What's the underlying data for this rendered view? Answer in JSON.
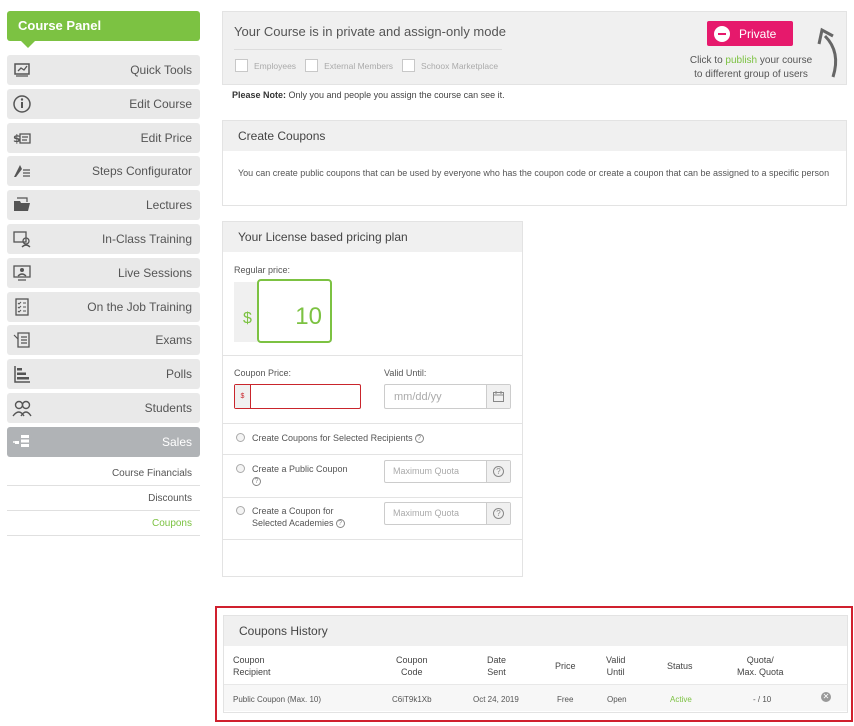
{
  "sidebar": {
    "header": "Course Panel",
    "items": [
      {
        "label": "Quick Tools",
        "icon": "board-icon"
      },
      {
        "label": "Edit Course",
        "icon": "info-icon"
      },
      {
        "label": "Edit Price",
        "icon": "price-icon"
      },
      {
        "label": "Steps Configurator",
        "icon": "steps-icon"
      },
      {
        "label": "Lectures",
        "icon": "folder-icon"
      },
      {
        "label": "In-Class Training",
        "icon": "classroom-icon"
      },
      {
        "label": "Live Sessions",
        "icon": "live-icon"
      },
      {
        "label": "On the Job Training",
        "icon": "checklist-icon"
      },
      {
        "label": "Exams",
        "icon": "exam-icon"
      },
      {
        "label": "Polls",
        "icon": "poll-icon"
      },
      {
        "label": "Students",
        "icon": "students-icon"
      },
      {
        "label": "Sales",
        "icon": "sales-icon"
      }
    ],
    "sub_items": [
      "Course Financials",
      "Discounts",
      "Coupons"
    ]
  },
  "privacy": {
    "title": "Your Course is in private and assign-only mode",
    "checkboxes": [
      "Employees",
      "External Members",
      "Schoox Marketplace"
    ],
    "button_label": "Private",
    "note_pre": "Click to ",
    "note_link": "publish",
    "note_post": " your course",
    "note_line2": "to different group of users",
    "please_bold": "Please Note:",
    "please_text": " Only you and people you assign the course can see it."
  },
  "create": {
    "title": "Create Coupons",
    "text": "You can create public coupons that can be used by everyone who has the coupon code or create a coupon that can be assigned to a specific person"
  },
  "license": {
    "title": "Your License based pricing plan",
    "regular_label": "Regular price:",
    "currency": "$",
    "regular_value": "10",
    "coupon_price_label": "Coupon Price:",
    "coupon_prefix": "$",
    "valid_until_label": "Valid Until:",
    "date_placeholder": "mm/dd/yy",
    "opt1": "Create Coupons for Selected Recipients",
    "opt2": "Create a Public Coupon",
    "opt3_line1": "Create a Coupon for",
    "opt3_line2": "Selected Academies",
    "quota_placeholder": "Maximum Quota"
  },
  "history": {
    "title": "Coupons History",
    "headers": [
      [
        "Coupon",
        "Recipient"
      ],
      [
        "Coupon",
        "Code"
      ],
      [
        "Date",
        "Sent"
      ],
      [
        "Price"
      ],
      [
        "Valid",
        "Until"
      ],
      [
        "Status"
      ],
      [
        "Quota/",
        "Max. Quota"
      ]
    ],
    "rows": [
      {
        "recipient": "Public Coupon (Max. 10)",
        "code": "C6iT9k1Xb",
        "date": "Oct 24, 2019",
        "price": "Free",
        "valid": "Open",
        "status": "Active",
        "quota": "- / 10"
      }
    ]
  },
  "colors": {
    "accent": "#7cc242",
    "private": "#e6196c",
    "highlight": "#d0202e"
  }
}
